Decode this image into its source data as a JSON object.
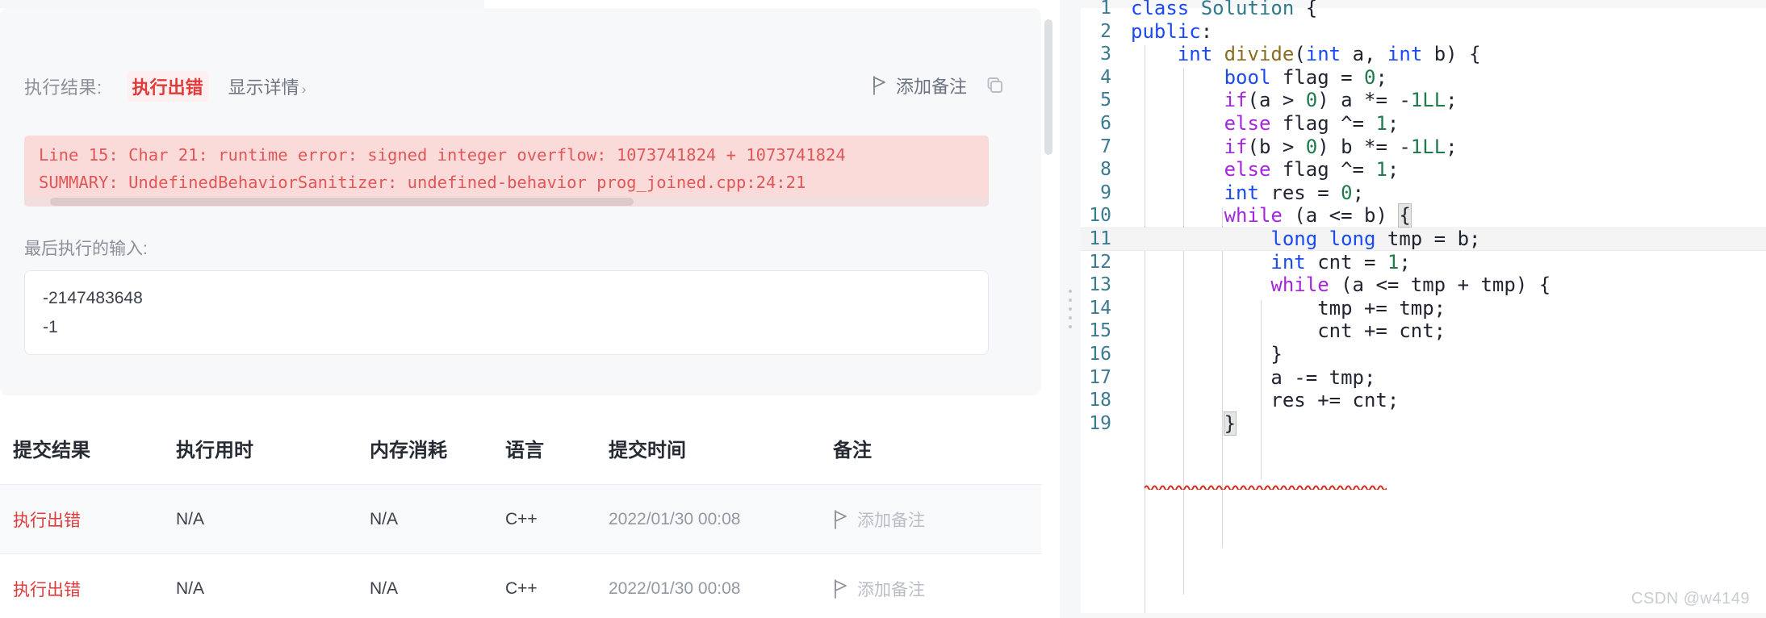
{
  "result_panel": {
    "result_label": "执行结果:",
    "status": "执行出错",
    "show_detail": "显示详情",
    "chevron": "›",
    "add_note": "添加备注",
    "error_lines": [
      "Line 15: Char 21: runtime error: signed integer overflow: 1073741824 + 1073741824",
      "SUMMARY: UndefinedBehaviorSanitizer: undefined-behavior prog_joined.cpp:24:21"
    ],
    "last_input_label": "最后执行的输入:",
    "last_input_values": [
      "-2147483648",
      "-1"
    ]
  },
  "submissions_table": {
    "headers": [
      "提交结果",
      "执行用时",
      "内存消耗",
      "语言",
      "提交时间",
      "备注"
    ],
    "rows": [
      {
        "result": "执行出错",
        "runtime": "N/A",
        "memory": "N/A",
        "language": "C++",
        "submitted_at": "2022/01/30 00:08",
        "note": "添加备注"
      },
      {
        "result": "执行出错",
        "runtime": "N/A",
        "memory": "N/A",
        "language": "C++",
        "submitted_at": "2022/01/30 00:08",
        "note": "添加备注"
      }
    ]
  },
  "editor": {
    "lines": [
      {
        "no": "1",
        "text": "class Solution {"
      },
      {
        "no": "2",
        "text": "public:"
      },
      {
        "no": "3",
        "text": "    int divide(int a, int b) {"
      },
      {
        "no": "4",
        "text": "        bool flag = 0;"
      },
      {
        "no": "5",
        "text": "        if(a > 0) a *= -1LL;"
      },
      {
        "no": "6",
        "text": "        else flag ^= 1;"
      },
      {
        "no": "7",
        "text": "        if(b > 0) b *= -1LL;"
      },
      {
        "no": "8",
        "text": "        else flag ^= 1;"
      },
      {
        "no": "9",
        "text": "        int res = 0;"
      },
      {
        "no": "10",
        "text": "        while (a <= b) {"
      },
      {
        "no": "11",
        "text": "            long long tmp = b;"
      },
      {
        "no": "12",
        "text": "            int cnt = 1;"
      },
      {
        "no": "13",
        "text": "            while (a <= tmp + tmp) {"
      },
      {
        "no": "14",
        "text": "                tmp += tmp;"
      },
      {
        "no": "15",
        "text": "                cnt += cnt;"
      },
      {
        "no": "16",
        "text": "            }"
      },
      {
        "no": "17",
        "text": "            a -= tmp;"
      },
      {
        "no": "18",
        "text": "            res += cnt;"
      },
      {
        "no": "19",
        "text": "        }"
      }
    ],
    "active_line": "11",
    "watermark": "CSDN @w4149"
  },
  "colors": {
    "error_red": "#e03a3a",
    "error_bg": "#fbdada",
    "panel_bg": "#f7f8fa",
    "keyword_purple": "#a626e0",
    "type_blue": "#1a4af0",
    "number_green": "#1f7a4d",
    "linenum_teal": "#3b7b91"
  }
}
